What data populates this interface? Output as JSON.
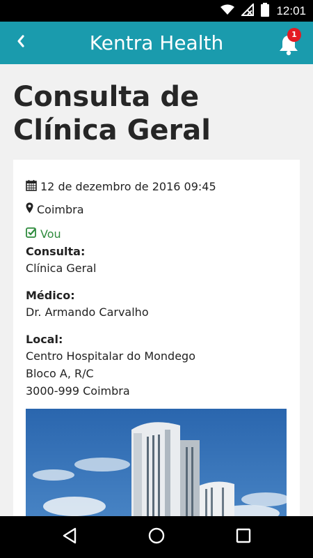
{
  "status_bar": {
    "time": "12:01",
    "icons": [
      "wifi-icon",
      "no-signal-icon",
      "battery-icon"
    ]
  },
  "app_bar": {
    "title": "Kentra Health",
    "notification_count": "1",
    "color": "#1a9bad"
  },
  "page": {
    "title": "Consulta de Clínica Geral"
  },
  "event": {
    "datetime": "12 de dezembro de 2016 09:45",
    "city": "Coimbra",
    "attendance": "Vou",
    "attendance_color": "#2e8b3d",
    "consulta_label": "Consulta:",
    "consulta_value": "Clínica Geral",
    "medico_label": "Médico:",
    "medico_value": "Dr. Armando Carvalho",
    "local_label": "Local:",
    "local_lines": [
      "Centro Hospitalar do Mondego",
      "Bloco A, R/C",
      "3000-999 Coimbra"
    ]
  },
  "nav_bar": {
    "buttons": [
      "back-triangle-icon",
      "home-circle-icon",
      "recents-square-icon"
    ]
  }
}
